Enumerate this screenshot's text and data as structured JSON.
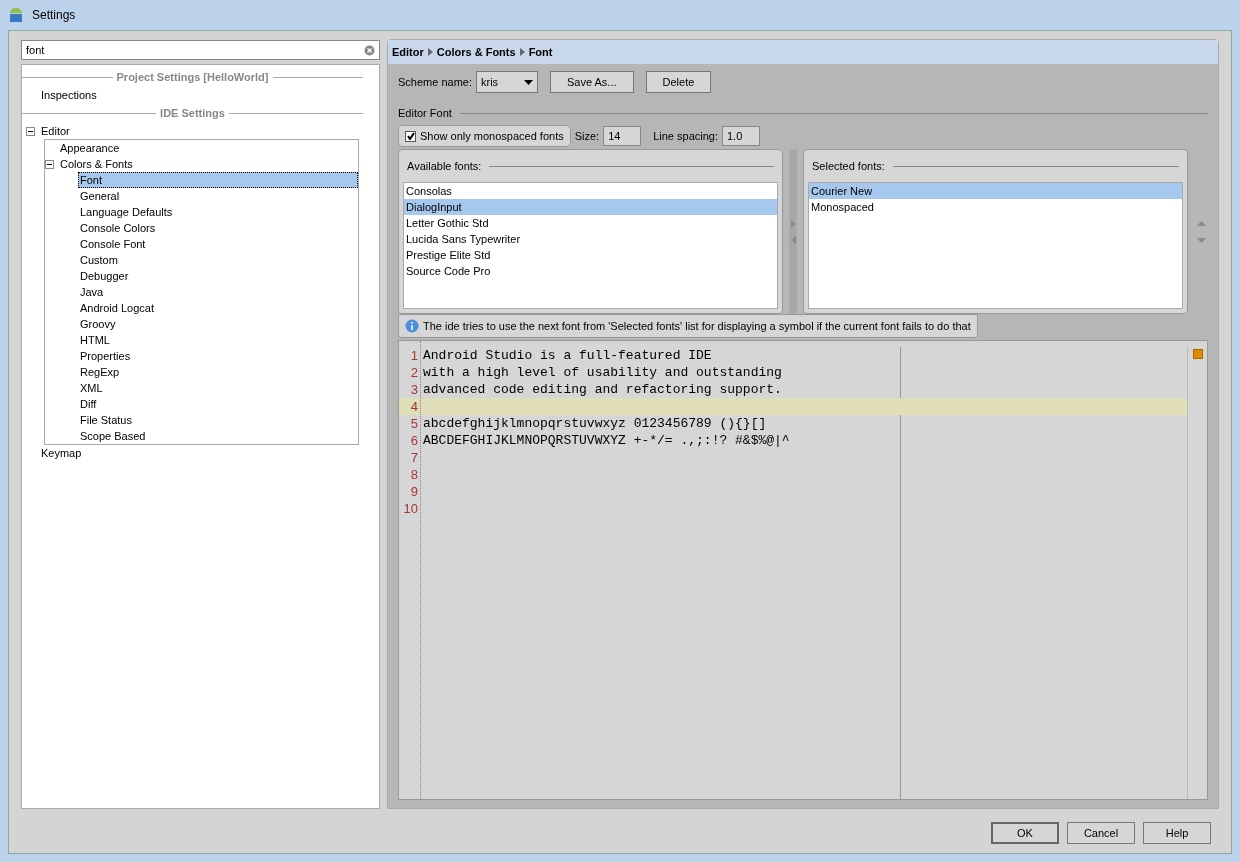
{
  "window": {
    "title": "Settings"
  },
  "search": {
    "value": "font"
  },
  "sidebar": {
    "sections": [
      {
        "title": "Project Settings [HelloWorld]",
        "items": [
          {
            "label": "Inspections",
            "selected": false
          }
        ]
      },
      {
        "title": "IDE Settings",
        "items": [
          {
            "label": "Editor",
            "selected": false,
            "expanded": true,
            "children": [
              {
                "label": "Appearance",
                "selected": false
              },
              {
                "label": "Colors & Fonts",
                "selected": false,
                "expanded": true,
                "children": [
                  {
                    "label": "Font",
                    "selected": true
                  },
                  {
                    "label": "General",
                    "selected": false
                  },
                  {
                    "label": "Language Defaults",
                    "selected": false
                  },
                  {
                    "label": "Console Colors",
                    "selected": false
                  },
                  {
                    "label": "Console Font",
                    "selected": false
                  },
                  {
                    "label": "Custom",
                    "selected": false
                  },
                  {
                    "label": "Debugger",
                    "selected": false
                  },
                  {
                    "label": "Java",
                    "selected": false
                  },
                  {
                    "label": "Android Logcat",
                    "selected": false
                  },
                  {
                    "label": "Groovy",
                    "selected": false
                  },
                  {
                    "label": "HTML",
                    "selected": false
                  },
                  {
                    "label": "Properties",
                    "selected": false
                  },
                  {
                    "label": "RegExp",
                    "selected": false
                  },
                  {
                    "label": "XML",
                    "selected": false
                  },
                  {
                    "label": "Diff",
                    "selected": false
                  },
                  {
                    "label": "File Status",
                    "selected": false
                  },
                  {
                    "label": "Scope Based",
                    "selected": false
                  }
                ]
              }
            ]
          },
          {
            "label": "Keymap",
            "selected": false
          }
        ]
      }
    ]
  },
  "breadcrumb": [
    "Editor",
    "Colors & Fonts",
    "Font"
  ],
  "scheme": {
    "label": "Scheme name:",
    "value": "kris",
    "buttons": [
      "Save As...",
      "Delete"
    ]
  },
  "editor_font": {
    "title": "Editor Font",
    "monospaced": {
      "label": "Show only monospaced fonts",
      "checked": true
    },
    "size_label": "Size:",
    "size": "14",
    "spacing_label": "Line spacing:",
    "spacing": "1.0"
  },
  "available": {
    "title": "Available fonts:",
    "items": [
      {
        "label": "Consolas",
        "selected": false
      },
      {
        "label": "DialogInput",
        "selected": true
      },
      {
        "label": "Letter Gothic Std",
        "selected": false
      },
      {
        "label": "Lucida Sans Typewriter",
        "selected": false
      },
      {
        "label": "Prestige Elite Std",
        "selected": false
      },
      {
        "label": "Source Code Pro",
        "selected": false
      }
    ]
  },
  "selected_fonts": {
    "title": "Selected fonts:",
    "items": [
      {
        "label": "Courier New",
        "selected": true
      },
      {
        "label": "Monospaced",
        "selected": false
      }
    ]
  },
  "hint": "The ide tries to use the next font from 'Selected fonts' list for displaying a symbol if the current font fails to do that",
  "preview": {
    "lines": [
      {
        "number": "1",
        "text": "Android Studio is a full-featured IDE",
        "current": false
      },
      {
        "number": "2",
        "text": "with a high level of usability and outstanding",
        "current": false
      },
      {
        "number": "3",
        "text": "advanced code editing and refactoring support.",
        "current": false
      },
      {
        "number": "4",
        "current": true
      },
      {
        "number": "5",
        "text": "abcdefghijklmnopqrstuvwxyz 0123456789 (){}[]",
        "current": false
      },
      {
        "number": "6",
        "text": "ABCDEFGHIJKLMNOPQRSTUVWXYZ +-*/= .,;:!? #&$%@|^",
        "current": false
      },
      {
        "number": "7",
        "current": false
      },
      {
        "number": "8",
        "current": false
      },
      {
        "number": "9",
        "current": false
      },
      {
        "number": "10",
        "current": false
      }
    ]
  },
  "buttons": [
    "OK",
    "Cancel",
    "Help"
  ]
}
